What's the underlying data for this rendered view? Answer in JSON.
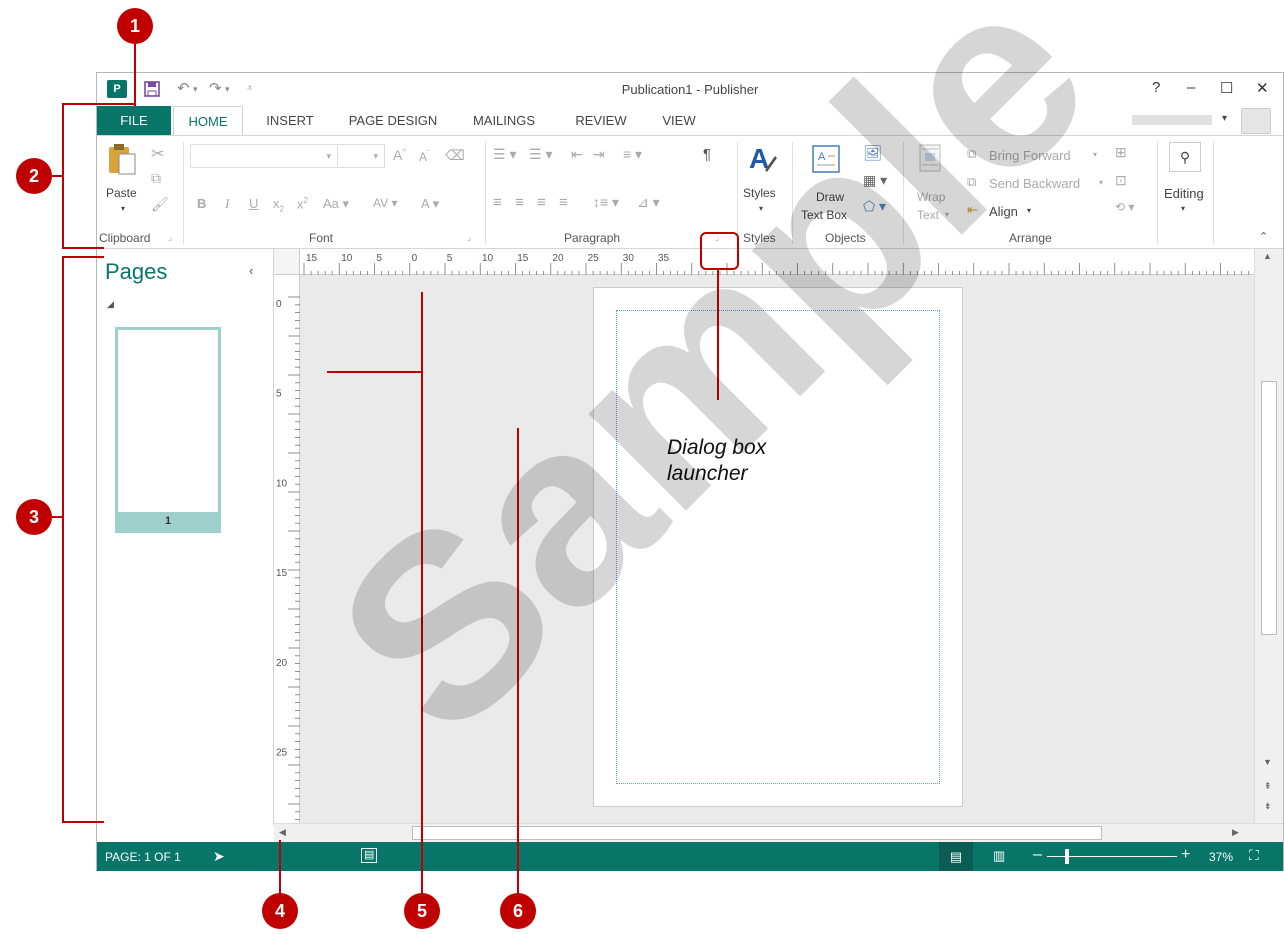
{
  "window": {
    "title": "Publication1 - Publisher",
    "help": "?",
    "minimize": "–",
    "maximize": "☐",
    "close": "✕"
  },
  "tabs": [
    {
      "label": "FILE"
    },
    {
      "label": "HOME"
    },
    {
      "label": "INSERT"
    },
    {
      "label": "PAGE DESIGN"
    },
    {
      "label": "MAILINGS"
    },
    {
      "label": "REVIEW"
    },
    {
      "label": "VIEW"
    }
  ],
  "ribbon": {
    "clipboard": {
      "paste": "Paste",
      "group": "Clipboard"
    },
    "font": {
      "group": "Font",
      "font_name": "",
      "font_size": ""
    },
    "paragraph": {
      "group": "Paragraph"
    },
    "styles": {
      "label": "Styles",
      "group": "Styles"
    },
    "objects": {
      "draw_line1": "Draw",
      "draw_line2": "Text Box",
      "group": "Objects"
    },
    "arrange": {
      "wrap_line1": "Wrap",
      "wrap_line2": "Text",
      "bring_forward": "Bring Forward",
      "send_backward": "Send Backward",
      "align": "Align",
      "group": "Arrange"
    },
    "editing": {
      "label": "Editing"
    }
  },
  "pages_pane": {
    "title": "Pages",
    "page_number": "1"
  },
  "hruler_ticks": [
    "15",
    "10",
    "5",
    "0",
    "5",
    "10",
    "15",
    "20",
    "25",
    "30",
    "35"
  ],
  "vruler_ticks": [
    "0",
    "5",
    "10",
    "15",
    "20",
    "25"
  ],
  "status": {
    "page": "PAGE: 1 OF 1",
    "zoom": "37%"
  },
  "annotations": {
    "callouts": [
      "1",
      "2",
      "3",
      "4",
      "5",
      "6"
    ],
    "dialog_label_line1": "Dialog box",
    "dialog_label_line2": "launcher",
    "watermark": "Sample"
  },
  "colors": {
    "accent": "#077568",
    "callout": "#c00000",
    "page_thumb": "#9dd0cb"
  }
}
